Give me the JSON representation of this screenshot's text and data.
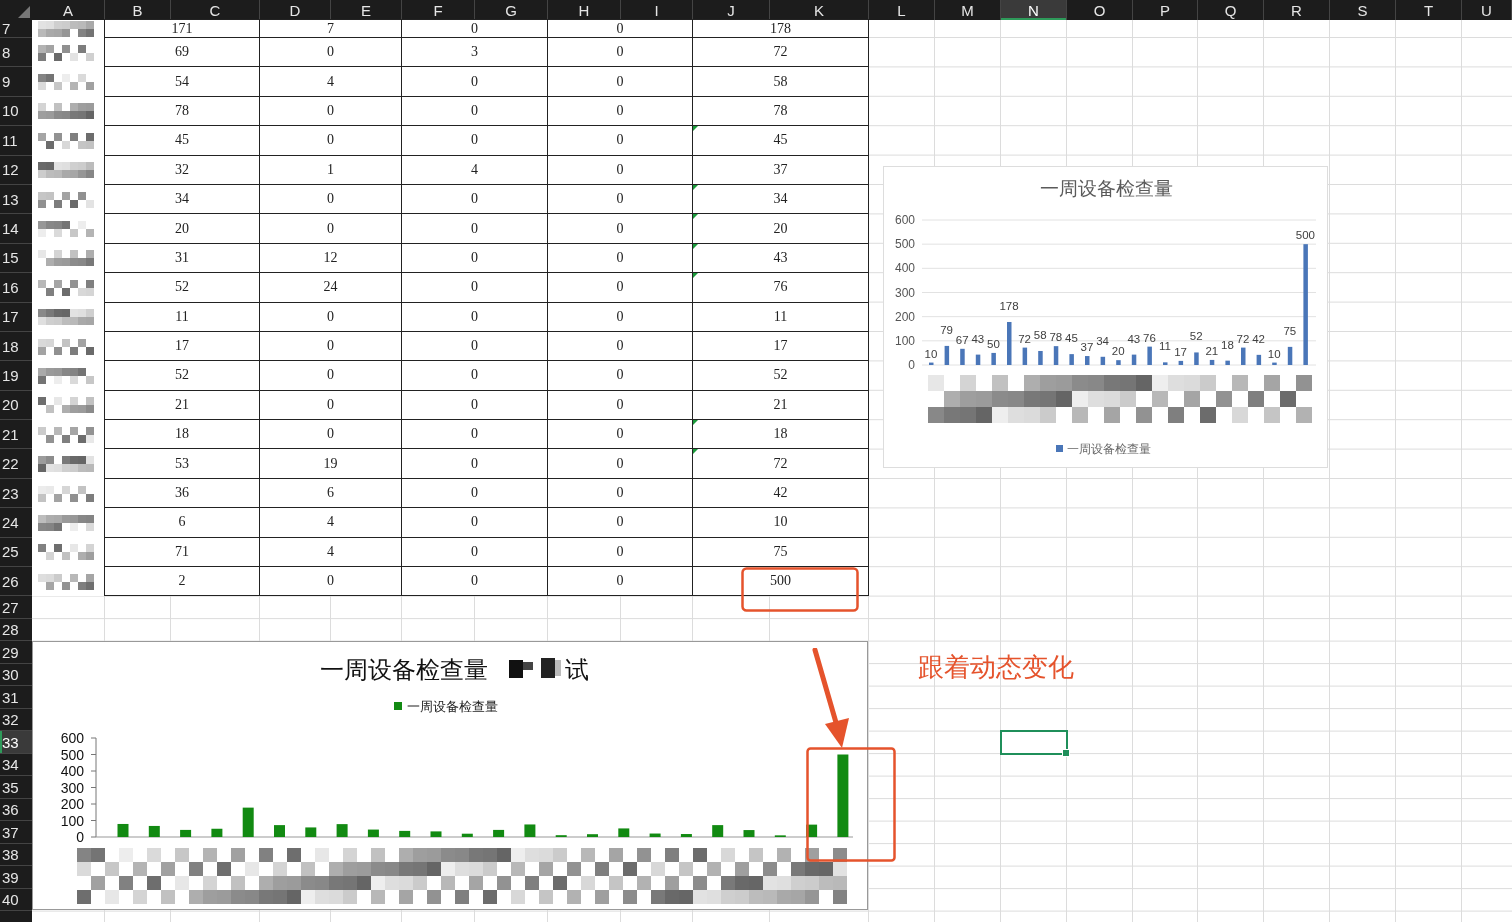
{
  "sheet": {
    "columns": [
      {
        "label": "A",
        "selected": false
      },
      {
        "label": "B",
        "selected": false
      },
      {
        "label": "C",
        "selected": false
      },
      {
        "label": "D",
        "selected": false
      },
      {
        "label": "E",
        "selected": false
      },
      {
        "label": "F",
        "selected": false
      },
      {
        "label": "G",
        "selected": false
      },
      {
        "label": "H",
        "selected": false
      },
      {
        "label": "I",
        "selected": false
      },
      {
        "label": "J",
        "selected": false
      },
      {
        "label": "K",
        "selected": false
      },
      {
        "label": "L",
        "selected": false
      },
      {
        "label": "M",
        "selected": false
      },
      {
        "label": "N",
        "selected": true
      },
      {
        "label": "O",
        "selected": false
      },
      {
        "label": "P",
        "selected": false
      },
      {
        "label": "Q",
        "selected": false
      },
      {
        "label": "R",
        "selected": false
      },
      {
        "label": "S",
        "selected": false
      },
      {
        "label": "T",
        "selected": false
      },
      {
        "label": "U",
        "selected": false
      }
    ],
    "rows": [
      {
        "label": "7",
        "selected": false
      },
      {
        "label": "8",
        "selected": false
      },
      {
        "label": "9",
        "selected": false
      },
      {
        "label": "10",
        "selected": false
      },
      {
        "label": "11",
        "selected": false
      },
      {
        "label": "12",
        "selected": false
      },
      {
        "label": "13",
        "selected": false
      },
      {
        "label": "14",
        "selected": false
      },
      {
        "label": "15",
        "selected": false
      },
      {
        "label": "16",
        "selected": false
      },
      {
        "label": "17",
        "selected": false
      },
      {
        "label": "18",
        "selected": false
      },
      {
        "label": "19",
        "selected": false
      },
      {
        "label": "20",
        "selected": false
      },
      {
        "label": "21",
        "selected": false
      },
      {
        "label": "22",
        "selected": false
      },
      {
        "label": "23",
        "selected": false
      },
      {
        "label": "24",
        "selected": false
      },
      {
        "label": "25",
        "selected": false
      },
      {
        "label": "26",
        "selected": false
      },
      {
        "label": "27",
        "selected": false
      },
      {
        "label": "28",
        "selected": false
      },
      {
        "label": "29",
        "selected": false
      },
      {
        "label": "30",
        "selected": false
      },
      {
        "label": "31",
        "selected": false
      },
      {
        "label": "32",
        "selected": false
      },
      {
        "label": "33",
        "selected": true
      },
      {
        "label": "34",
        "selected": false
      },
      {
        "label": "35",
        "selected": false
      },
      {
        "label": "36",
        "selected": false
      },
      {
        "label": "37",
        "selected": false
      },
      {
        "label": "38",
        "selected": false
      },
      {
        "label": "39",
        "selected": false
      },
      {
        "label": "40",
        "selected": false
      }
    ]
  },
  "table": {
    "rows": [
      {
        "cells": [
          "171",
          "7",
          "0",
          "0",
          "178"
        ],
        "flagged": false
      },
      {
        "cells": [
          "69",
          "0",
          "3",
          "0",
          "72"
        ],
        "flagged": false
      },
      {
        "cells": [
          "54",
          "4",
          "0",
          "0",
          "58"
        ],
        "flagged": false
      },
      {
        "cells": [
          "78",
          "0",
          "0",
          "0",
          "78"
        ],
        "flagged": false
      },
      {
        "cells": [
          "45",
          "0",
          "0",
          "0",
          "45"
        ],
        "flagged": true
      },
      {
        "cells": [
          "32",
          "1",
          "4",
          "0",
          "37"
        ],
        "flagged": false
      },
      {
        "cells": [
          "34",
          "0",
          "0",
          "0",
          "34"
        ],
        "flagged": true
      },
      {
        "cells": [
          "20",
          "0",
          "0",
          "0",
          "20"
        ],
        "flagged": true
      },
      {
        "cells": [
          "31",
          "12",
          "0",
          "0",
          "43"
        ],
        "flagged": true
      },
      {
        "cells": [
          "52",
          "24",
          "0",
          "0",
          "76"
        ],
        "flagged": true
      },
      {
        "cells": [
          "11",
          "0",
          "0",
          "0",
          "11"
        ],
        "flagged": false
      },
      {
        "cells": [
          "17",
          "0",
          "0",
          "0",
          "17"
        ],
        "flagged": false
      },
      {
        "cells": [
          "52",
          "0",
          "0",
          "0",
          "52"
        ],
        "flagged": false
      },
      {
        "cells": [
          "21",
          "0",
          "0",
          "0",
          "21"
        ],
        "flagged": false
      },
      {
        "cells": [
          "18",
          "0",
          "0",
          "0",
          "18"
        ],
        "flagged": true
      },
      {
        "cells": [
          "53",
          "19",
          "0",
          "0",
          "72"
        ],
        "flagged": true
      },
      {
        "cells": [
          "36",
          "6",
          "0",
          "0",
          "42"
        ],
        "flagged": false
      },
      {
        "cells": [
          "6",
          "4",
          "0",
          "0",
          "10"
        ],
        "flagged": false
      },
      {
        "cells": [
          "71",
          "4",
          "0",
          "0",
          "75"
        ],
        "flagged": false
      },
      {
        "cells": [
          "2",
          "0",
          "0",
          "0",
          "500"
        ],
        "flagged": false
      }
    ]
  },
  "charts": [
    {
      "chart_data": {
        "type": "bar",
        "title": "一周设备检查量",
        "ylim": [
          0,
          600
        ],
        "yticks": [
          0,
          100,
          200,
          300,
          400,
          500,
          600
        ],
        "data_labels": true,
        "grid": true,
        "series": [
          {
            "name": "一周设备检查量",
            "color": "#4a76b8",
            "values": [
              10,
              79,
              67,
              43,
              50,
              178,
              72,
              58,
              78,
              45,
              37,
              34,
              20,
              43,
              76,
              11,
              17,
              52,
              21,
              18,
              72,
              42,
              10,
              75,
              500
            ]
          }
        ]
      }
    },
    {
      "title_suffix": "试",
      "chart_data": {
        "type": "bar",
        "title": "一周设备检查量",
        "ylim": [
          0,
          600
        ],
        "yticks": [
          0,
          100,
          200,
          300,
          400,
          500,
          600
        ],
        "series": [
          {
            "name": "一周设备检查量",
            "color": "#128a12",
            "values": [
              79,
              67,
              43,
              50,
              178,
              72,
              58,
              78,
              45,
              37,
              34,
              20,
              43,
              76,
              11,
              17,
              52,
              21,
              18,
              72,
              42,
              10,
              75,
              500
            ]
          }
        ]
      }
    }
  ],
  "annotation": {
    "text": "跟着动态变化"
  }
}
